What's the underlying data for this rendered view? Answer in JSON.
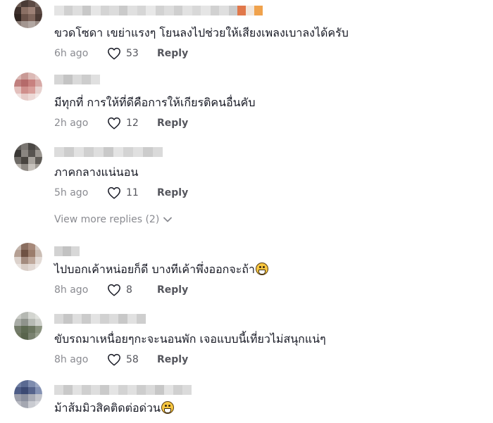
{
  "comments": [
    {
      "text": "ขวดโซดา เขย่าแรงๆ โยนลงไปช่วยให้เสียงเพลงเบาลงได้ครับ",
      "time": "6h ago",
      "likes": "53",
      "reply_label": "Reply"
    },
    {
      "text": "มีทุกที่ การให้ที่ดีคือการให้เกียรติคนอื่นคับ",
      "time": "2h ago",
      "likes": "12",
      "reply_label": "Reply"
    },
    {
      "text": "ภาคกลางแน่นอน",
      "time": "5h ago",
      "likes": "11",
      "reply_label": "Reply"
    },
    {
      "text": "ไปบอกเค้าหน่อยก็ดี บางทีเค้าพึ่งออกจะถ้า",
      "time": "8h ago",
      "likes": "8",
      "reply_label": "Reply"
    },
    {
      "text": "ขับรถมาเหนื่อยๆกะจะนอนพัก เจอแบบนี้เที่ยวไม่สนุกแน่ๆ",
      "time": "8h ago",
      "likes": "58",
      "reply_label": "Reply"
    },
    {
      "text": "ม้าส้มมิวสิคติดต่อด่วน",
      "time": "",
      "likes": "",
      "reply_label": ""
    }
  ],
  "view_more_replies": "View more replies (2)",
  "icons": {
    "like": "heart-outline-icon",
    "expand": "chevron-down-icon",
    "emoji": "grinning-face-emoji"
  },
  "colors": {
    "text": "#161823",
    "meta": "#8a8b91",
    "reply": "#54555c"
  }
}
